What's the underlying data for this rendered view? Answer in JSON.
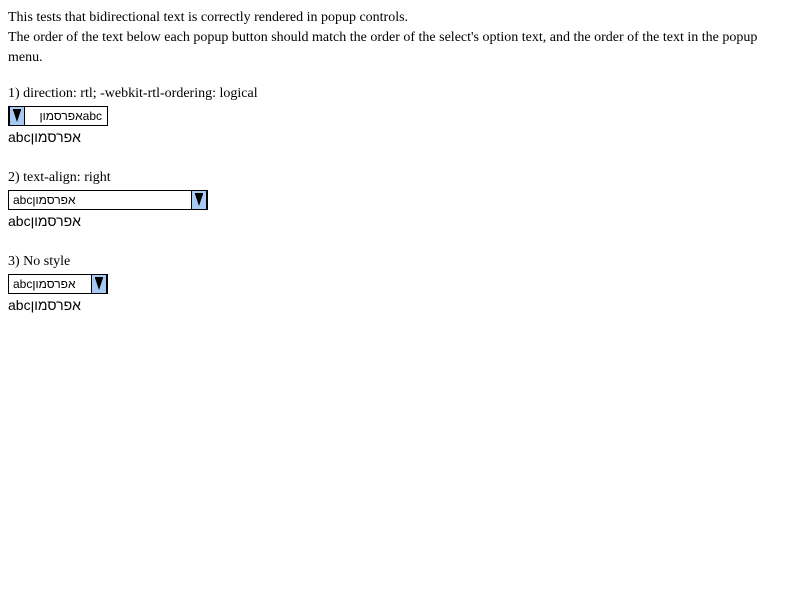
{
  "intro": {
    "line1": "This tests that bidirectional text is correctly rendered in popup controls.",
    "line2": "The order of the text below each popup button should match the order of the select's option text, and the order of the text in the popup menu."
  },
  "cases": [
    {
      "label": "1) direction: rtl; -webkit-rtl-ordering: logical",
      "popup_value": "אפרסמוןabc",
      "result_text": "abcאפרסמון"
    },
    {
      "label": "2) text-align: right",
      "popup_value": "abcאפרסמון",
      "result_text": "abcאפרסמון"
    },
    {
      "label": "3) No style",
      "popup_value": "abcאפרסמון",
      "result_text": "abcאפרסמון"
    }
  ],
  "icons": {
    "dropdown": "chevron-down-icon"
  },
  "colors": {
    "arrow_background": "#a7c9f2",
    "border": "#000000"
  }
}
